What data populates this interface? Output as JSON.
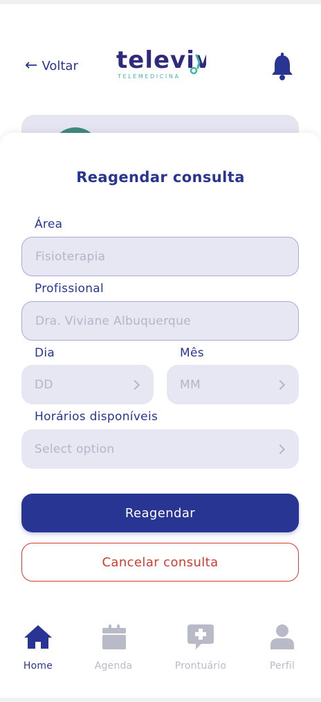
{
  "header": {
    "back_label": "Voltar",
    "logo_text": "televiv",
    "logo_subtitle": "TELEMEDICINA"
  },
  "form": {
    "title": "Reagendar consulta",
    "area": {
      "label": "Área",
      "placeholder": "Fisioterapia"
    },
    "professional": {
      "label": "Profissional",
      "placeholder": "Dra. Viviane Albuquerque"
    },
    "day": {
      "label": "Dia",
      "placeholder": "DD"
    },
    "month": {
      "label": "Mês",
      "placeholder": "MM"
    },
    "times": {
      "label": "Horários disponíveis",
      "placeholder": "Select option"
    },
    "submit_label": "Reagendar",
    "cancel_label": "Cancelar consulta"
  },
  "nav": {
    "items": [
      {
        "label": "Home",
        "icon": "home-icon",
        "active": true
      },
      {
        "label": "Agenda",
        "icon": "calendar-icon",
        "active": false
      },
      {
        "label": "Prontuário",
        "icon": "medical-chat-icon",
        "active": false
      },
      {
        "label": "Perfil",
        "icon": "user-icon",
        "active": false
      }
    ]
  },
  "colors": {
    "primary": "#283593",
    "field_bg": "#e6e7f2",
    "placeholder": "#b3b5c9",
    "danger": "#d23a2f",
    "logo_teal": "#3fb7a4",
    "logo_purple": "#2f2a7d",
    "nav_inactive": "#b8bac8"
  }
}
